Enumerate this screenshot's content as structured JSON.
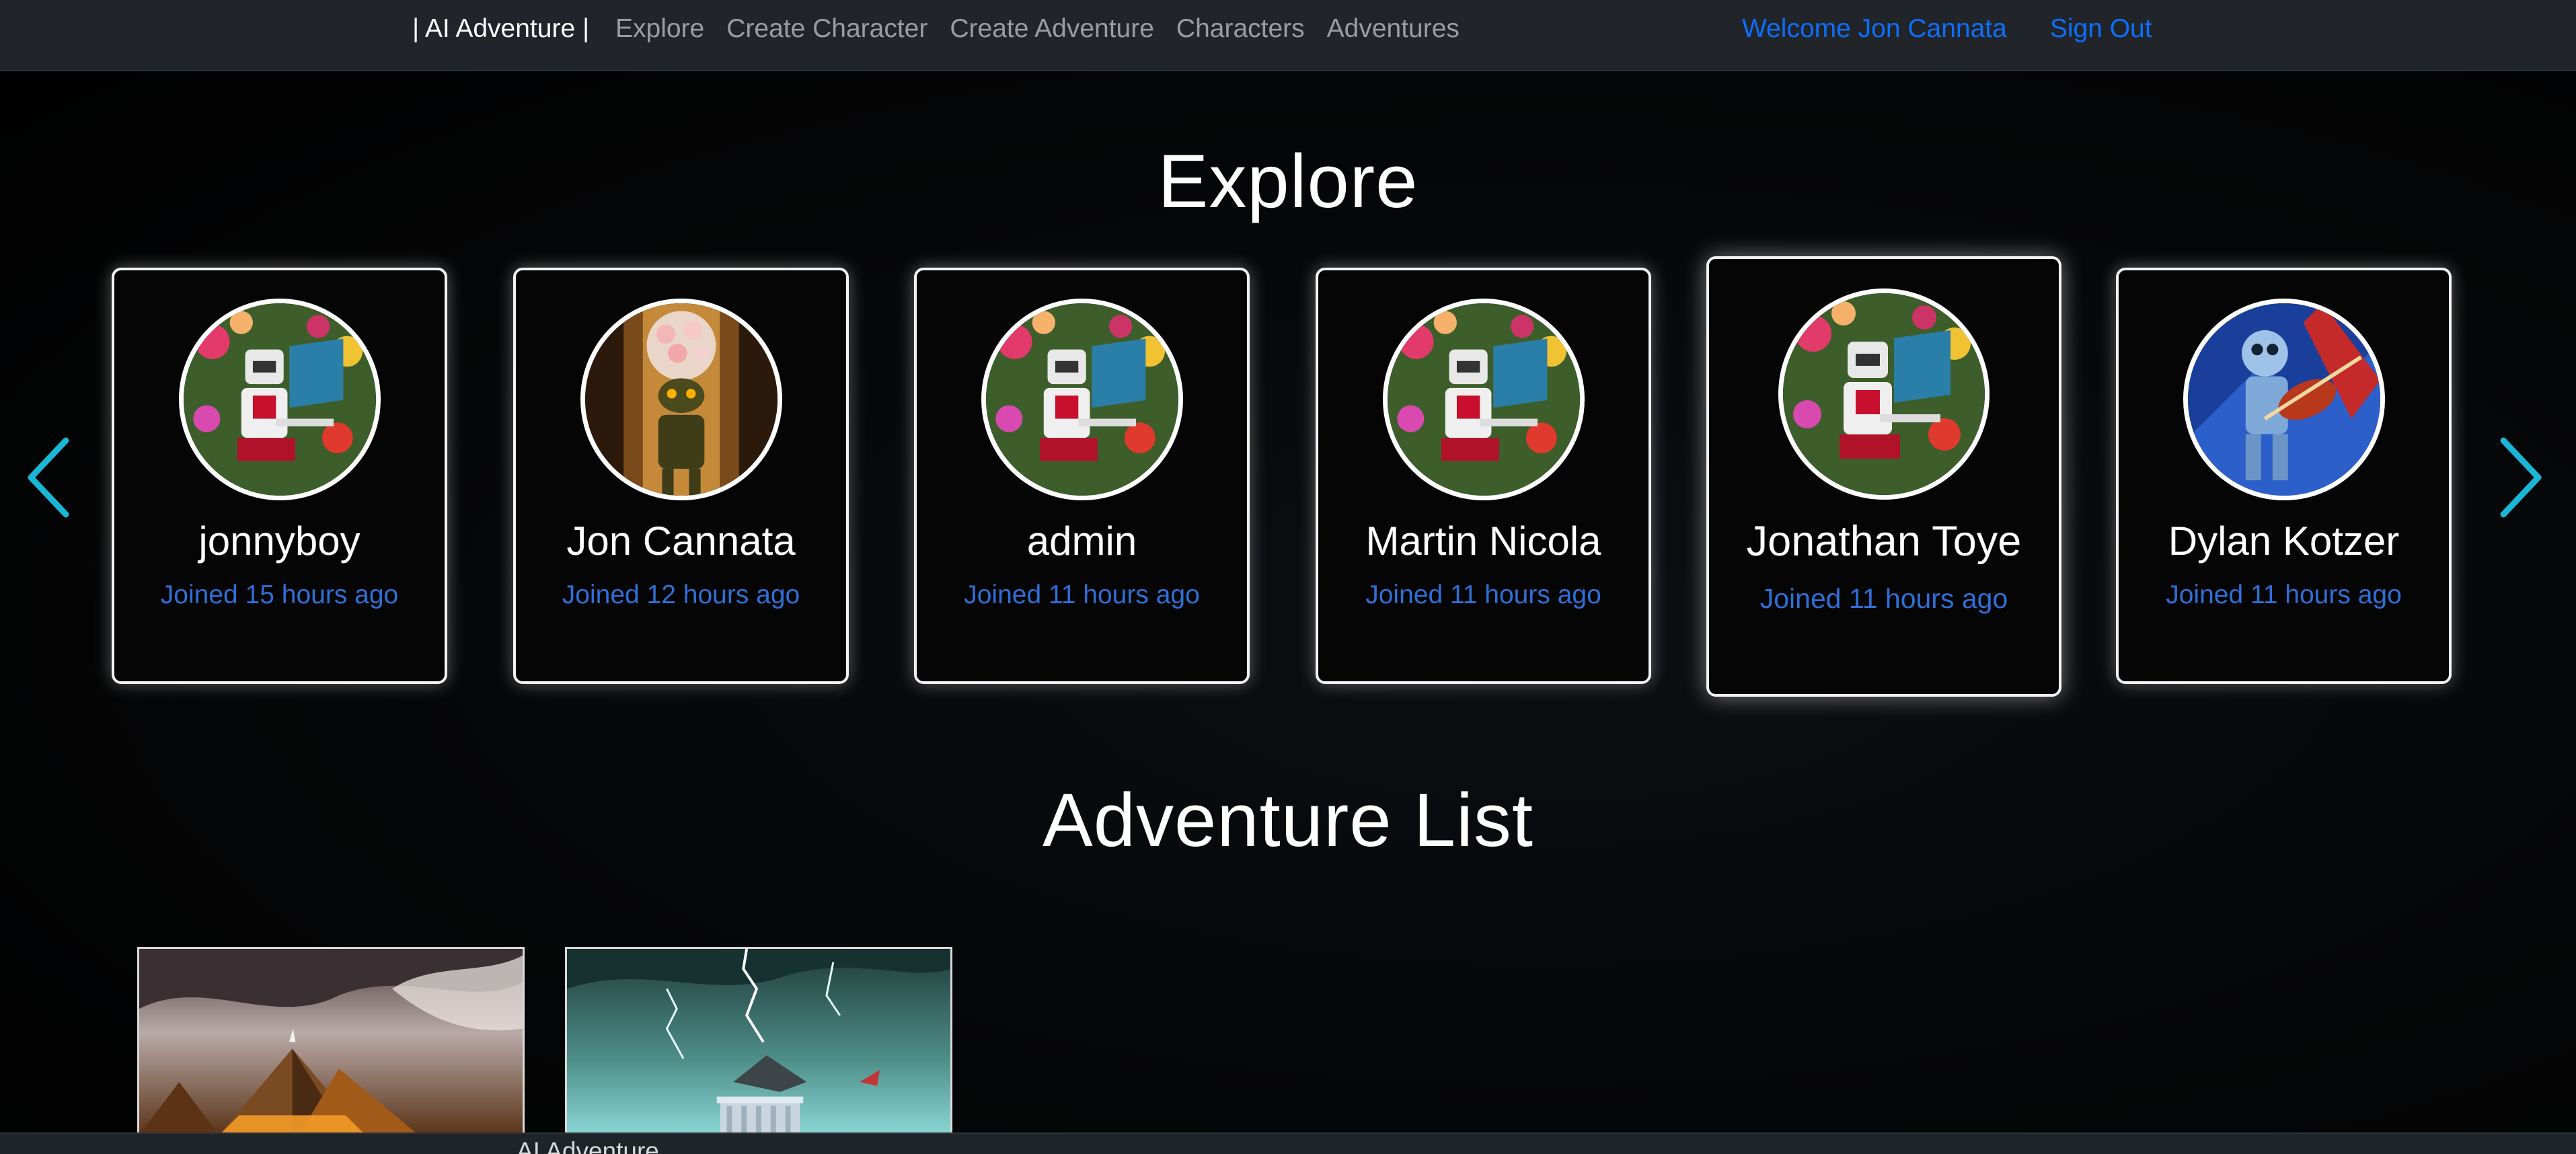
{
  "navbar": {
    "brand": "| AI Adventure |",
    "links": [
      "Explore",
      "Create Character",
      "Create Adventure",
      "Characters",
      "Adventures"
    ],
    "welcome": "Welcome Jon Cannata",
    "sign_out": "Sign Out"
  },
  "explore": {
    "title": "Explore",
    "users": [
      {
        "name": "jonnyboy",
        "joined": "Joined 15 hours ago",
        "avatar": "robot-painter-avatar"
      },
      {
        "name": "Jon Cannata",
        "joined": "Joined 12 hours ago",
        "avatar": "flower-head-robot-avatar"
      },
      {
        "name": "admin",
        "joined": "Joined 11 hours ago",
        "avatar": "robot-painter-avatar"
      },
      {
        "name": "Martin Nicola",
        "joined": "Joined 11 hours ago",
        "avatar": "robot-painter-avatar"
      },
      {
        "name": "Jonathan Toye",
        "joined": "Joined 11 hours ago",
        "avatar": "robot-painter-avatar"
      },
      {
        "name": "Dylan Kotzer",
        "joined": "Joined 11 hours ago",
        "avatar": "violin-robot-avatar"
      }
    ],
    "prev_icon": "chevron-left-icon",
    "next_icon": "chevron-right-icon"
  },
  "adventures": {
    "title": "Adventure List",
    "items": [
      {
        "image": "pyramid-mountain-image"
      },
      {
        "image": "lightning-temple-image"
      }
    ]
  },
  "footer": {
    "brand": "AI Adventure"
  },
  "colors": {
    "navbar_bg": "#212529",
    "link_blue": "#0d6efd",
    "arrow_cyan": "#1ab6d6"
  }
}
